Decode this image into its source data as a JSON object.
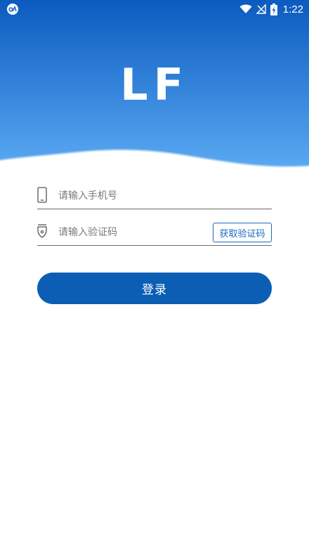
{
  "status_bar": {
    "time": "1:22"
  },
  "logo": {
    "text": "LF"
  },
  "phone_field": {
    "placeholder": "请输入手机号",
    "value": ""
  },
  "code_field": {
    "placeholder": "请输入验证码",
    "value": ""
  },
  "get_code_button": {
    "label": "获取验证码"
  },
  "login_button": {
    "label": "登录"
  },
  "colors": {
    "header_top": "#0b5bc0",
    "header_bottom": "#59a8f2",
    "primary": "#0c5eb4",
    "accent": "#1a6bbd"
  }
}
